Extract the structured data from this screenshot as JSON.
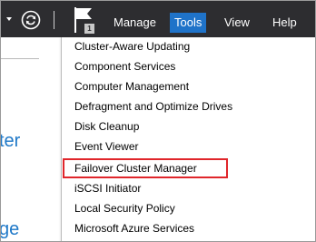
{
  "menubar": {
    "items": [
      "Manage",
      "Tools",
      "View",
      "Help"
    ],
    "active": "Tools",
    "notification_count": "1"
  },
  "left_pane": {
    "text_fragment_1": "ter",
    "text_fragment_2": "ge"
  },
  "tools_menu": {
    "items": [
      "Cluster-Aware Updating",
      "Component Services",
      "Computer Management",
      "Defragment and Optimize Drives",
      "Disk Cleanup",
      "Event Viewer",
      "Failover Cluster Manager",
      "iSCSI Initiator",
      "Local Security Policy",
      "Microsoft Azure Services"
    ],
    "highlighted_item": "Failover Cluster Manager"
  },
  "colors": {
    "menubar_background": "#2d2d30",
    "active_menu_background": "#1f73c9",
    "highlight_border": "#e0262b",
    "link_blue": "#1e78c8"
  },
  "icons": [
    "dropdown-arrow-icon",
    "refresh-icon",
    "notification-flag-icon"
  ]
}
